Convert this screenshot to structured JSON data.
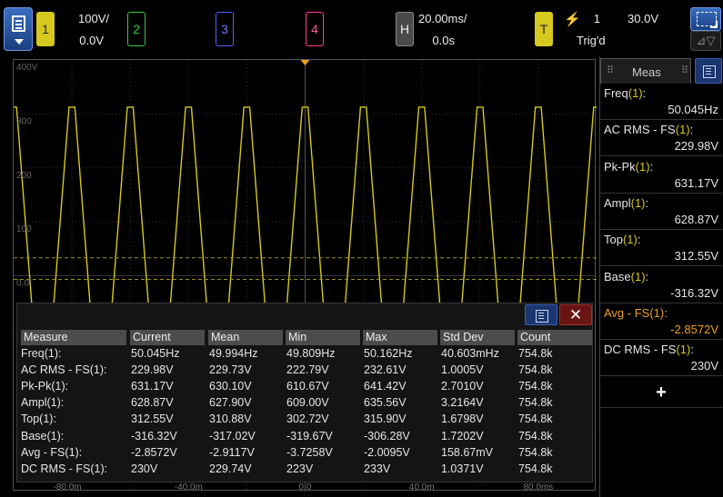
{
  "top_bar": {
    "ch1": {
      "key": "1",
      "scale": "100V/",
      "offset": "0.0V"
    },
    "ch2": {
      "key": "2"
    },
    "ch3": {
      "key": "3"
    },
    "ch4": {
      "key": "4"
    },
    "horizontal": {
      "key": "H",
      "scale": "20.00ms/",
      "delay": "0.0s"
    },
    "trigger": {
      "key": "T",
      "source": "1",
      "level": "30.0V",
      "status": "Trig'd"
    }
  },
  "colors": {
    "ch1": "#d7c820",
    "ch2": "#3cc83c",
    "ch3": "#4a62ff",
    "ch4": "#ff3c8a",
    "highlight": "#f0a020"
  },
  "graticule": {
    "y_labels": [
      "400V",
      "300",
      "200",
      "100",
      "0.0"
    ],
    "x_labels": [
      "-80.0m",
      "-40.0m",
      "0.0",
      "40.0m",
      "80.0ms"
    ]
  },
  "waveform": {
    "description_free": true,
    "cycles": 10,
    "peak": 312.55,
    "base": -316.32,
    "v_per_div": 100,
    "ms_per_div": 20
  },
  "table": {
    "headers": [
      "Measure",
      "Current",
      "Mean",
      "Min",
      "Max",
      "Std Dev",
      "Count"
    ],
    "rows": [
      {
        "name": "Freq",
        "ch": "(1)",
        "suffix": ":",
        "current": "50.045Hz",
        "mean": "49.994Hz",
        "min": "49.809Hz",
        "max": "50.162Hz",
        "std": "40.603mHz",
        "count": "754.8k"
      },
      {
        "name": "AC RMS - FS",
        "ch": "(1)",
        "suffix": ":",
        "current": "229.98V",
        "mean": "229.73V",
        "min": "222.79V",
        "max": "232.61V",
        "std": "1.0005V",
        "count": "754.8k"
      },
      {
        "name": "Pk-Pk",
        "ch": "(1)",
        "suffix": ":",
        "current": "631.17V",
        "mean": "630.10V",
        "min": "610.67V",
        "max": "641.42V",
        "std": "2.7010V",
        "count": "754.8k"
      },
      {
        "name": "Ampl",
        "ch": "(1)",
        "suffix": ":",
        "current": "628.87V",
        "mean": "627.90V",
        "min": "609.00V",
        "max": "635.56V",
        "std": "3.2164V",
        "count": "754.8k"
      },
      {
        "name": "Top",
        "ch": "(1)",
        "suffix": ":",
        "current": "312.55V",
        "mean": "310.88V",
        "min": "302.72V",
        "max": "315.90V",
        "std": "1.6798V",
        "count": "754.8k"
      },
      {
        "name": "Base",
        "ch": "(1)",
        "suffix": ":",
        "current": "-316.32V",
        "mean": "-317.02V",
        "min": "-319.67V",
        "max": "-306.28V",
        "std": "1.7202V",
        "count": "754.8k"
      },
      {
        "name": "Avg - FS",
        "ch": "(1)",
        "suffix": ":",
        "current": "-2.8572V",
        "mean": "-2.9117V",
        "min": "-3.7258V",
        "max": "-2.0095V",
        "std": "158.67mV",
        "count": "754.8k"
      },
      {
        "name": "DC RMS - FS",
        "ch": "(1)",
        "suffix": ":",
        "current": "230V",
        "mean": "229.74V",
        "min": "223V",
        "max": "233V",
        "std": "1.0371V",
        "count": "754.8k"
      }
    ]
  },
  "meas_panel": {
    "title": "Meas",
    "add_label": "+",
    "items": [
      {
        "name": "Freq",
        "ch": "(1)",
        "suffix": ":",
        "value": "50.045Hz"
      },
      {
        "name": "AC RMS - FS",
        "ch": "(1)",
        "suffix": ":",
        "value": "229.98V"
      },
      {
        "name": "Pk-Pk",
        "ch": "(1)",
        "suffix": ":",
        "value": "631.17V"
      },
      {
        "name": "Ampl",
        "ch": "(1)",
        "suffix": ":",
        "value": "628.87V"
      },
      {
        "name": "Top",
        "ch": "(1)",
        "suffix": ":",
        "value": "312.55V"
      },
      {
        "name": "Base",
        "ch": "(1)",
        "suffix": ":",
        "value": "-316.32V"
      },
      {
        "name": "Avg - FS",
        "ch": "(1)",
        "suffix": ":",
        "value": "-2.8572V"
      },
      {
        "name": "DC RMS - FS",
        "ch": "(1)",
        "suffix": ":",
        "value": "230V"
      }
    ]
  }
}
